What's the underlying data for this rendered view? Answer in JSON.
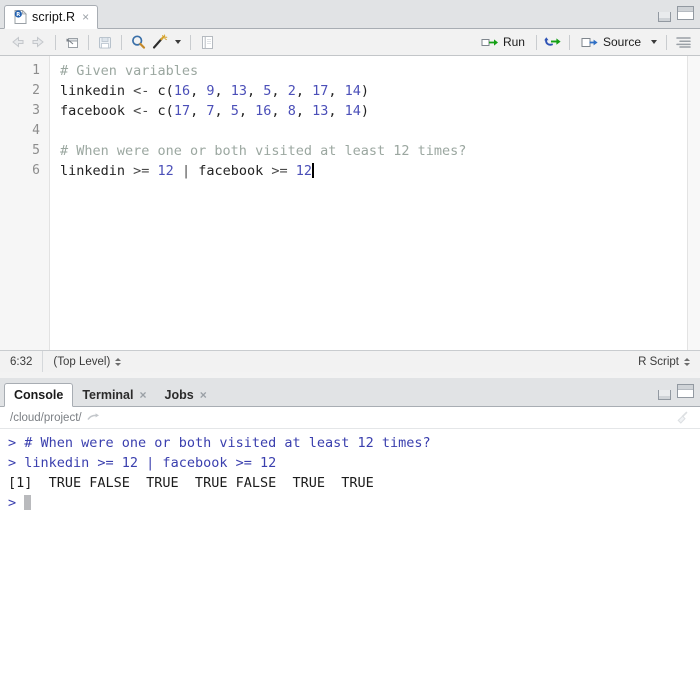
{
  "window": {
    "minimize_label": "minimize",
    "maximize_label": "maximize"
  },
  "source_pane": {
    "tab": {
      "icon": "r-document-icon",
      "title": "script.R",
      "close": "×"
    },
    "toolbar": {
      "back_icon": "back-arrow-icon",
      "forward_icon": "forward-arrow-icon",
      "popout_icon": "popout-window-icon",
      "save_icon": "save-disk-icon",
      "find_icon": "magnifier-icon",
      "wand_icon": "magic-wand-icon",
      "wand_caret": "caret-down-icon",
      "notebook_icon": "notebook-icon",
      "run_label": "Run",
      "run_icon": "run-arrow-icon",
      "rerun_icon": "rerun-loop-icon",
      "source_label": "Source",
      "source_icon": "source-arrow-icon",
      "source_caret": "caret-down-icon",
      "outline_icon": "document-outline-icon"
    },
    "editor": {
      "line_numbers": [
        "1",
        "2",
        "3",
        "4",
        "5",
        "6"
      ],
      "lines": [
        {
          "segments": [
            {
              "text": "# Given variables",
              "type": "comment"
            }
          ]
        },
        {
          "segments": [
            {
              "text": "linkedin ",
              "type": "plain"
            },
            {
              "text": "<- ",
              "type": "op"
            },
            {
              "text": "c(",
              "type": "plain"
            },
            {
              "text": "16",
              "type": "num"
            },
            {
              "text": ", ",
              "type": "plain"
            },
            {
              "text": "9",
              "type": "num"
            },
            {
              "text": ", ",
              "type": "plain"
            },
            {
              "text": "13",
              "type": "num"
            },
            {
              "text": ", ",
              "type": "plain"
            },
            {
              "text": "5",
              "type": "num"
            },
            {
              "text": ", ",
              "type": "plain"
            },
            {
              "text": "2",
              "type": "num"
            },
            {
              "text": ", ",
              "type": "plain"
            },
            {
              "text": "17",
              "type": "num"
            },
            {
              "text": ", ",
              "type": "plain"
            },
            {
              "text": "14",
              "type": "num"
            },
            {
              "text": ")",
              "type": "plain"
            }
          ]
        },
        {
          "segments": [
            {
              "text": "facebook ",
              "type": "plain"
            },
            {
              "text": "<- ",
              "type": "op"
            },
            {
              "text": "c(",
              "type": "plain"
            },
            {
              "text": "17",
              "type": "num"
            },
            {
              "text": ", ",
              "type": "plain"
            },
            {
              "text": "7",
              "type": "num"
            },
            {
              "text": ", ",
              "type": "plain"
            },
            {
              "text": "5",
              "type": "num"
            },
            {
              "text": ", ",
              "type": "plain"
            },
            {
              "text": "16",
              "type": "num"
            },
            {
              "text": ", ",
              "type": "plain"
            },
            {
              "text": "8",
              "type": "num"
            },
            {
              "text": ", ",
              "type": "plain"
            },
            {
              "text": "13",
              "type": "num"
            },
            {
              "text": ", ",
              "type": "plain"
            },
            {
              "text": "14",
              "type": "num"
            },
            {
              "text": ")",
              "type": "plain"
            }
          ]
        },
        {
          "segments": []
        },
        {
          "segments": [
            {
              "text": "# When were one or both visited at least 12 times?",
              "type": "comment"
            }
          ]
        },
        {
          "segments": [
            {
              "text": "linkedin ",
              "type": "plain"
            },
            {
              "text": ">= ",
              "type": "op"
            },
            {
              "text": "12",
              "type": "num"
            },
            {
              "text": " | ",
              "type": "op"
            },
            {
              "text": "facebook ",
              "type": "plain"
            },
            {
              "text": ">= ",
              "type": "op"
            },
            {
              "text": "12",
              "type": "num"
            }
          ],
          "cursor": true
        }
      ]
    },
    "status": {
      "cursor_position": "6:32",
      "scope": "(Top Level)",
      "file_type": "R Script"
    }
  },
  "console_pane": {
    "tabs": [
      {
        "label": "Console",
        "active": true,
        "closeable": false
      },
      {
        "label": "Terminal",
        "active": false,
        "closeable": true,
        "close": "×"
      },
      {
        "label": "Jobs",
        "active": false,
        "closeable": true,
        "close": "×"
      }
    ],
    "path": "/cloud/project/",
    "path_icon": "open-in-new-window-icon",
    "clear_icon": "broom-clear-icon",
    "lines": [
      {
        "prompt": "> ",
        "text": "# When were one or both visited at least 12 times?",
        "style": "input"
      },
      {
        "prompt": "> ",
        "text": "linkedin >= 12 | facebook >= 12",
        "style": "input"
      },
      {
        "prompt": "",
        "text": "[1]  TRUE FALSE  TRUE  TRUE FALSE  TRUE  TRUE",
        "style": "output"
      },
      {
        "prompt": "> ",
        "text": "",
        "style": "input",
        "cursor": true
      }
    ]
  },
  "colors": {
    "comment": "#9ba7a0",
    "number": "#4b4fb8",
    "console_blue": "#3a3fae",
    "run_green": "#15a015",
    "tab_bar": "#e1e3e5"
  }
}
